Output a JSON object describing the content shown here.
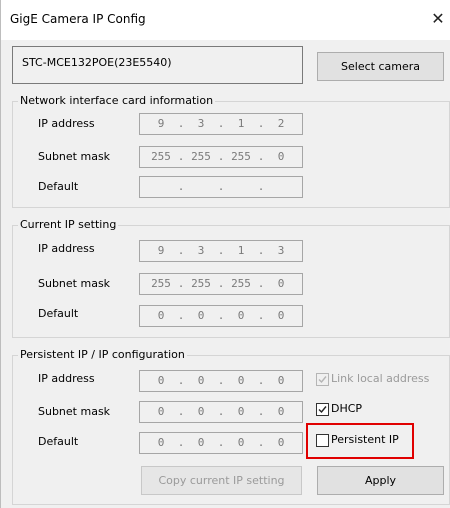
{
  "window": {
    "title": "GigE Camera IP Config",
    "close_glyph": "✕"
  },
  "camera": {
    "selected": "STC-MCE132POE(23E5540)",
    "select_label": "Select camera"
  },
  "nic": {
    "title": "Network interface card information",
    "ip_label": "IP address",
    "subnet_label": "Subnet mask",
    "default_label": "Default",
    "ip": [
      "9",
      "3",
      "1",
      "2"
    ],
    "subnet": [
      "255",
      "255",
      "255",
      "0"
    ],
    "default": [
      "",
      "",
      "",
      ""
    ]
  },
  "current": {
    "title": "Current IP setting",
    "ip_label": "IP address",
    "subnet_label": "Subnet mask",
    "default_label": "Default",
    "ip": [
      "9",
      "3",
      "1",
      "3"
    ],
    "subnet": [
      "255",
      "255",
      "255",
      "0"
    ],
    "default": [
      "0",
      "0",
      "0",
      "0"
    ]
  },
  "persistent": {
    "title": "Persistent IP / IP configuration",
    "ip_label": "IP address",
    "subnet_label": "Subnet mask",
    "default_label": "Default",
    "ip": [
      "0",
      "0",
      "0",
      "0"
    ],
    "subnet": [
      "0",
      "0",
      "0",
      "0"
    ],
    "default": [
      "0",
      "0",
      "0",
      "0"
    ],
    "lla": {
      "label": "Link local address",
      "checked": true,
      "enabled": false
    },
    "dhcp": {
      "label": "DHCP",
      "checked": true
    },
    "persistent_ip": {
      "label": "Persistent IP",
      "checked": false
    },
    "copy_label": "Copy current IP setting",
    "apply_label": "Apply"
  },
  "colors": {
    "highlight": "#e00000"
  }
}
